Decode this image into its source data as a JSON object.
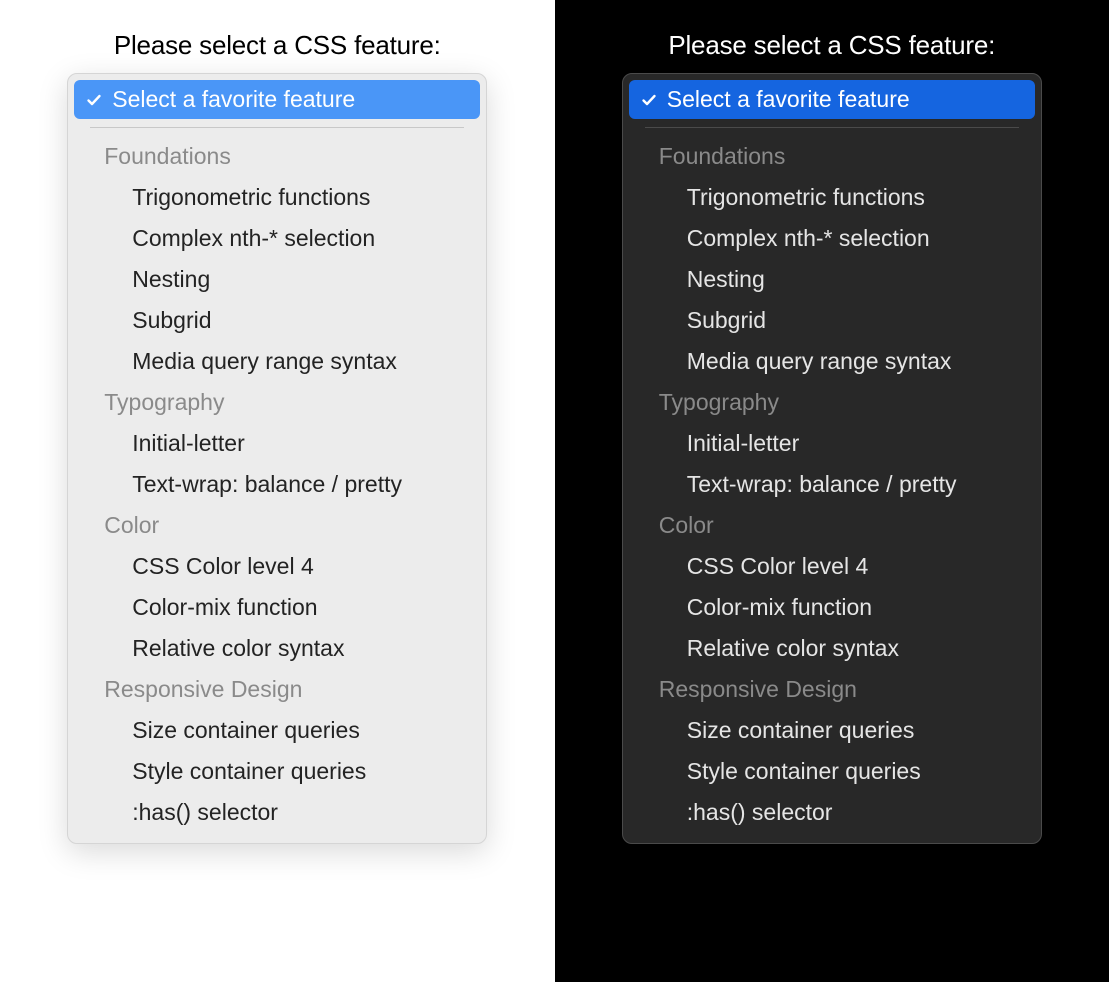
{
  "prompt": "Please select a CSS feature:",
  "selected_label": "Select a favorite feature",
  "colors": {
    "light_accent": "#4a96f7",
    "dark_accent": "#1565e0"
  },
  "groups": [
    {
      "label": "Foundations",
      "options": [
        "Trigonometric functions",
        "Complex nth-* selection",
        "Nesting",
        "Subgrid",
        "Media query range syntax"
      ]
    },
    {
      "label": "Typography",
      "options": [
        "Initial-letter",
        "Text-wrap: balance / pretty"
      ]
    },
    {
      "label": "Color",
      "options": [
        "CSS Color level 4",
        "Color-mix function",
        "Relative color syntax"
      ]
    },
    {
      "label": "Responsive Design",
      "options": [
        "Size container queries",
        "Style container queries",
        ":has() selector"
      ]
    }
  ]
}
